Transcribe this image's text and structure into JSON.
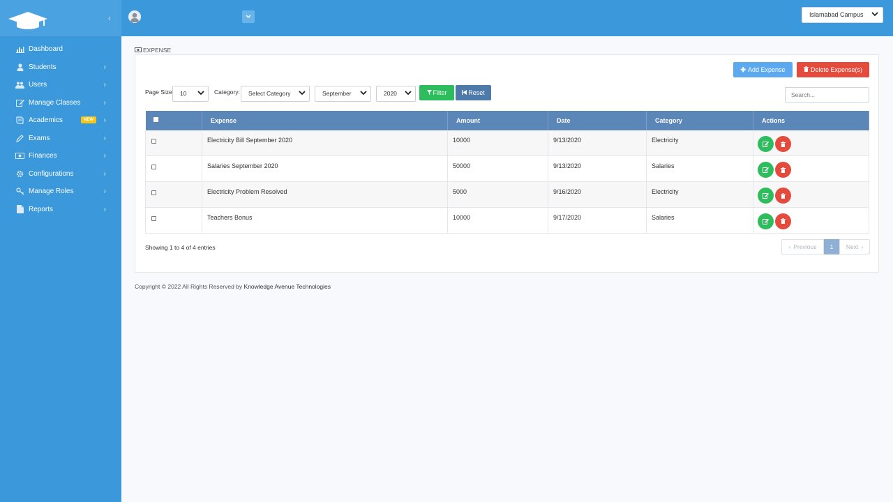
{
  "sidebar": {
    "items": [
      {
        "label": "Dashboard",
        "icon": "bar-chart-icon",
        "has_arrow": false
      },
      {
        "label": "Students",
        "icon": "user-icon",
        "has_arrow": true
      },
      {
        "label": "Users",
        "icon": "users-icon",
        "has_arrow": true
      },
      {
        "label": "Manage Classes",
        "icon": "edit-icon",
        "has_arrow": true
      },
      {
        "label": "Academics",
        "icon": "book-icon",
        "has_arrow": true,
        "badge": "NEW"
      },
      {
        "label": "Exams",
        "icon": "pencil-icon",
        "has_arrow": true
      },
      {
        "label": "Finances",
        "icon": "money-icon",
        "has_arrow": true
      },
      {
        "label": "Configurations",
        "icon": "gear-icon",
        "has_arrow": true
      },
      {
        "label": "Manage Roles",
        "icon": "key-icon",
        "has_arrow": true
      },
      {
        "label": "Reports",
        "icon": "file-icon",
        "has_arrow": true
      }
    ]
  },
  "topbar": {
    "campus": "Islamabad Campus"
  },
  "page": {
    "title": "EXPENSE",
    "add_label": "Add Expense",
    "delete_label": "Delete Expense(s)",
    "filters": {
      "page_size_label": "Page Size:",
      "page_size": "10",
      "category_label": "Category:",
      "category": "Select Category",
      "month": "September",
      "year": "2020",
      "filter_label": "Filter",
      "reset_label": "Reset"
    },
    "search_placeholder": "Search..."
  },
  "table": {
    "columns": [
      "Expense",
      "Amount",
      "Date",
      "Category",
      "Actions"
    ],
    "rows": [
      {
        "expense": "Electricity Bill September 2020",
        "amount": "10000",
        "date": "9/13/2020",
        "category": "Electricity"
      },
      {
        "expense": "Salaries September 2020",
        "amount": "50000",
        "date": "9/13/2020",
        "category": "Salaries"
      },
      {
        "expense": "Electricity Problem Resolved",
        "amount": "5000",
        "date": "9/16/2020",
        "category": "Electricity"
      },
      {
        "expense": "Teachers Bonus",
        "amount": "10000",
        "date": "9/17/2020",
        "category": "Salaries"
      }
    ]
  },
  "pagination": {
    "showing": "Showing 1 to 4 of 4 entries",
    "previous": "Previous",
    "current": "1",
    "next": "Next"
  },
  "footer": {
    "text": "Copyright © 2022 All Rights Reserved by",
    "company": "Knowledge Avenue Technologies"
  },
  "colors": {
    "sidebar": "#3a98db",
    "header": "#5b86b8",
    "success": "#2dbd5d",
    "danger": "#e54b3c",
    "primary": "#5ca9f0"
  }
}
